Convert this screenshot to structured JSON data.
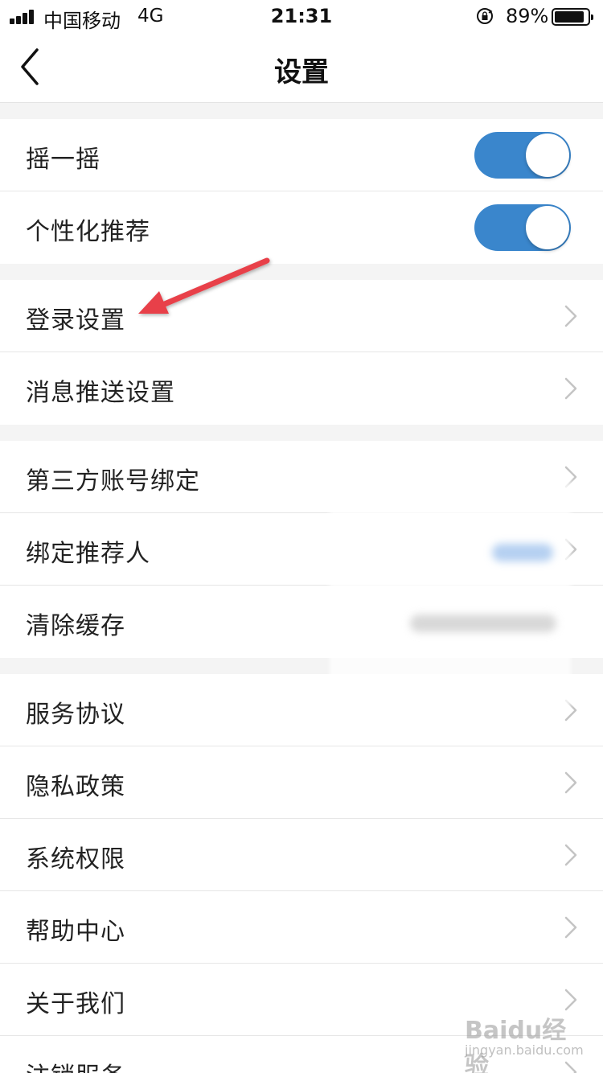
{
  "status_bar": {
    "carrier": "中国移动",
    "network": "4G",
    "time": "21:31",
    "battery_pct": "89%",
    "battery_level": 0.89,
    "icons": [
      "signal-icon",
      "rotation-lock-icon",
      "battery-icon"
    ]
  },
  "nav": {
    "title": "设置",
    "back_icon": "chevron-left-icon"
  },
  "colors": {
    "toggle_on": "#3a86cc",
    "annotation_arrow": "#e8414a",
    "chevron": "#c4c4c4",
    "background": "#f4f4f4"
  },
  "groups": [
    {
      "items": [
        {
          "label": "摇一摇",
          "control": "toggle",
          "on": true
        },
        {
          "label": "个性化推荐",
          "control": "toggle",
          "on": true
        }
      ]
    },
    {
      "items": [
        {
          "label": "登录设置",
          "control": "chevron"
        },
        {
          "label": "消息推送设置",
          "control": "chevron"
        }
      ]
    },
    {
      "items": [
        {
          "label": "第三方账号绑定",
          "control": "chevron"
        },
        {
          "label": "绑定推荐人",
          "control": "chevron"
        },
        {
          "label": "清除缓存",
          "control": "none"
        }
      ]
    },
    {
      "items": [
        {
          "label": "服务协议",
          "control": "chevron"
        },
        {
          "label": "隐私政策",
          "control": "chevron"
        },
        {
          "label": "系统权限",
          "control": "chevron"
        },
        {
          "label": "帮助中心",
          "control": "chevron"
        },
        {
          "label": "关于我们",
          "control": "chevron"
        },
        {
          "label": "注销服务",
          "control": "chevron"
        }
      ]
    }
  ],
  "watermark": {
    "logo": "Baidu经验",
    "url": "jingyan.baidu.com"
  }
}
